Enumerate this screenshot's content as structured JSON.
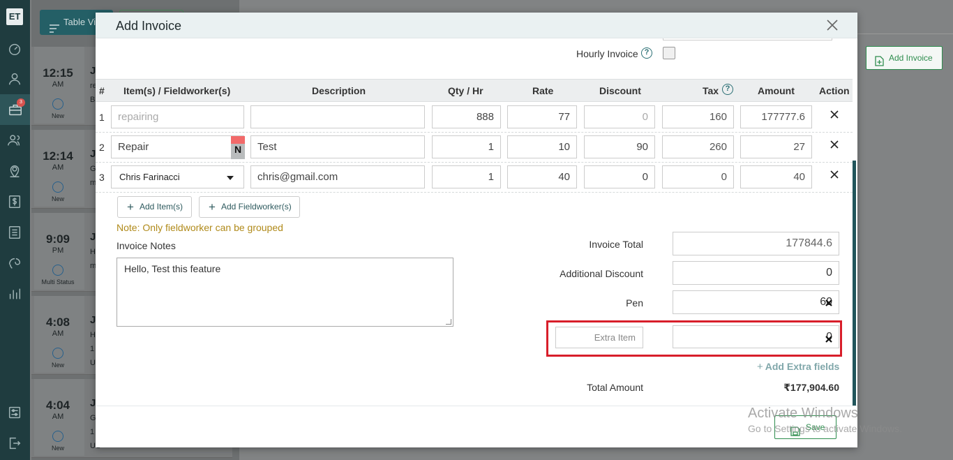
{
  "nav": {
    "logo": "ET",
    "badge_count": "3",
    "icons": [
      "dashboard-icon",
      "user-icon",
      "briefcase-icon",
      "users-icon",
      "location-icon",
      "dollar-icon",
      "list-icon",
      "tag-icon",
      "chart-icon",
      "settings-icon",
      "logout-icon"
    ]
  },
  "background": {
    "table_view_label": "Table Vie",
    "add_invoice_label": "Add Invoice",
    "events": [
      {
        "time": "12:15",
        "ampm": "AM",
        "status": "New",
        "title": "Ji",
        "sub": "re",
        "sub2": "B"
      },
      {
        "time": "12:14",
        "ampm": "AM",
        "status": "New",
        "title": "Ji",
        "sub": "G",
        "sub2": "m"
      },
      {
        "time": "9:09",
        "ampm": "PM",
        "status": "Multi Status",
        "title": "Ji",
        "sub": "H",
        "sub2": "m"
      },
      {
        "time": "4:08",
        "ampm": "AM",
        "status": "New",
        "title": "Ji",
        "sub": "H",
        "sub2": "1",
        "sub3": "U"
      },
      {
        "time": "4:04",
        "ampm": "AM",
        "status": "New",
        "title": "Ji",
        "sub": "G",
        "sub2": "1",
        "sub3": "US"
      }
    ]
  },
  "modal": {
    "title": "Add Invoice",
    "hourly_invoice_label": "Hourly Invoice",
    "hourly_help": "?",
    "table": {
      "headers": {
        "num": "#",
        "items": "Item(s) / Fieldworker(s)",
        "description": "Description",
        "qty": "Qty / Hr",
        "rate": "Rate",
        "discount": "Discount",
        "tax": "Tax",
        "amount": "Amount",
        "action": "Action"
      },
      "tax_help": "?",
      "rows": [
        {
          "num": "1",
          "item": "repairing",
          "description": "",
          "qty": "888",
          "rate": "77",
          "discount": "0",
          "tax": "160",
          "amount": "177777.6"
        },
        {
          "num": "2",
          "item": "Repair",
          "badge": "N",
          "description": "Test",
          "qty": "1",
          "rate": "10",
          "discount": "90",
          "tax": "260",
          "amount": "27"
        },
        {
          "num": "3",
          "item": "Chris Farinacci",
          "description": "chris@gmail.com",
          "qty": "1",
          "rate": "40",
          "discount": "0",
          "tax": "0",
          "amount": "40"
        }
      ]
    },
    "add_items_label": "Add Item(s)",
    "add_fieldworker_label": "Add Fieldworker(s)",
    "note": "Note: Only fieldworker can be grouped",
    "invoice_notes_label": "Invoice Notes",
    "invoice_notes_value": "Hello, Test this feature",
    "summary": {
      "invoice_total_label": "Invoice Total",
      "invoice_total_value": "177844.6",
      "additional_discount_label": "Additional Discount",
      "additional_discount_value": "0",
      "pen_label": "Pen",
      "pen_value": "60",
      "extra_item_placeholder": "Extra Item",
      "extra_item_value": "0",
      "add_extra_fields_label": "Add Extra fields",
      "total_amount_label": "Total Amount",
      "total_amount_value": "₹177,904.60"
    },
    "save_label": "Save",
    "highlight_color": "#d81e2a"
  },
  "watermark": {
    "line1": "Activate Windows",
    "line2": "Go to Settings to activate Windows."
  }
}
